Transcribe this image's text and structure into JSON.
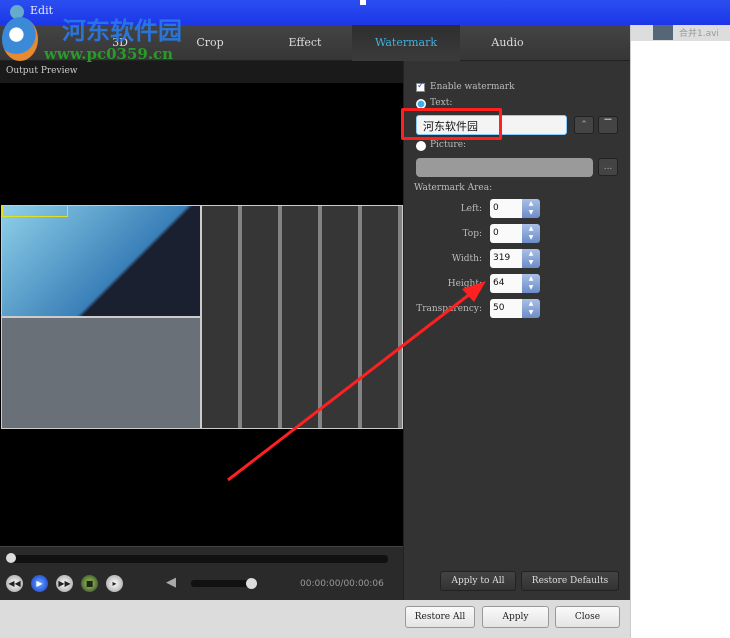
{
  "window": {
    "title": "Edit"
  },
  "logo": {
    "name": "河东软件园",
    "url": "www.pc0359.cn"
  },
  "tabs": [
    {
      "label": "3D"
    },
    {
      "label": "Crop"
    },
    {
      "label": "Effect"
    },
    {
      "label": "Watermark",
      "active": true
    },
    {
      "label": "Audio"
    }
  ],
  "preview": {
    "title": "Output Preview"
  },
  "watermark": {
    "enable_label": "Enable watermark",
    "enabled": true,
    "text_label": "Text:",
    "text_value": "河东软件园",
    "picture_label": "Picture:",
    "picture_value": "",
    "browse_label": "...",
    "area_label": "Watermark Area:",
    "fields": [
      {
        "label": "Left:",
        "value": "0"
      },
      {
        "label": "Top:",
        "value": "0"
      },
      {
        "label": "Width:",
        "value": "319"
      },
      {
        "label": "Height:",
        "value": "64"
      },
      {
        "label": "Transparency:",
        "value": "50"
      }
    ],
    "apply_all": "Apply to All",
    "restore_defaults": "Restore Defaults"
  },
  "player": {
    "time": "00:00:00/00:00:06",
    "progress": 0,
    "volume": 1.0
  },
  "footer": {
    "restore_all": "Restore All",
    "apply": "Apply",
    "close": "Close"
  },
  "side": {
    "file": "合并1.avi"
  },
  "colors": {
    "accent": "#3fb0e0",
    "highlight": "#ff2020",
    "titlebar": "#2a4ef0"
  }
}
